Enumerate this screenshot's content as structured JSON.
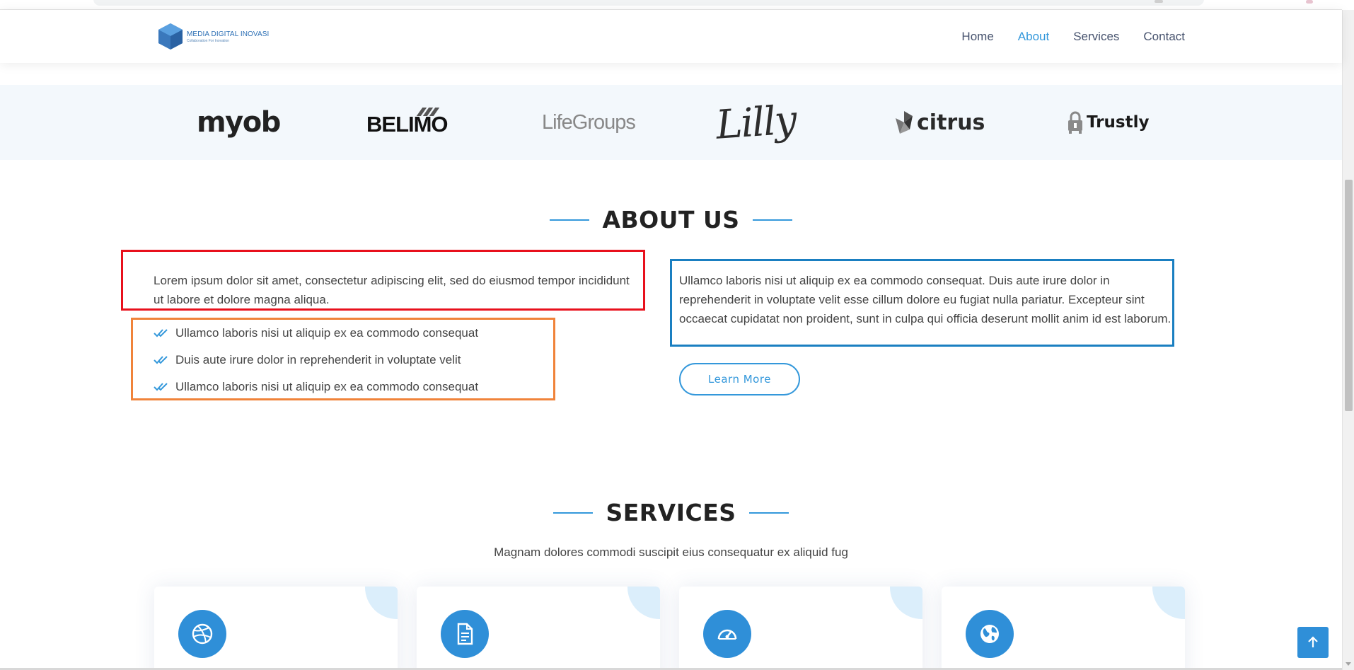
{
  "header": {
    "logo": {
      "title": "MEDIA DIGITAL INOVASI",
      "subtitle": "Collaboration For Inovation"
    },
    "nav": [
      {
        "label": "Home",
        "active": false
      },
      {
        "label": "About",
        "active": true
      },
      {
        "label": "Services",
        "active": false
      },
      {
        "label": "Contact",
        "active": false
      }
    ]
  },
  "clients": {
    "logos": [
      "myob",
      "BELIMO",
      "LifeGroups",
      "Lilly",
      "citrus",
      "Trustly"
    ]
  },
  "about": {
    "title": "ABOUT US",
    "lead": "Lorem ipsum dolor sit amet, consectetur adipiscing elit, sed do eiusmod tempor incididunt ut labore et dolore magna aliqua.",
    "list": [
      "Ullamco laboris nisi ut aliquip ex ea commodo consequat",
      "Duis aute irure dolor in reprehenderit in voluptate velit",
      "Ullamco laboris nisi ut aliquip ex ea commodo consequat"
    ],
    "right_text": "Ullamco laboris nisi ut aliquip ex ea commodo consequat. Duis aute irure dolor in reprehenderit in voluptate velit esse cillum dolore eu fugiat nulla pariatur. Excepteur sint occaecat cupidatat non proident, sunt in culpa qui officia deserunt mollit anim id est laborum.",
    "button_label": "Learn More"
  },
  "services": {
    "title": "SERVICES",
    "subtitle": "Magnam dolores commodi suscipit eius consequatur ex aliquid fug",
    "cards": [
      {
        "icon": "dribbble-icon"
      },
      {
        "icon": "file-text-icon"
      },
      {
        "icon": "speedometer-icon"
      },
      {
        "icon": "globe-icon"
      }
    ]
  },
  "colors": {
    "accent": "#3498db",
    "annotation_red": "#e8101c",
    "annotation_orange": "#f0833a",
    "annotation_blue": "#1a7fc1",
    "clients_bg": "#f3f8fc"
  }
}
